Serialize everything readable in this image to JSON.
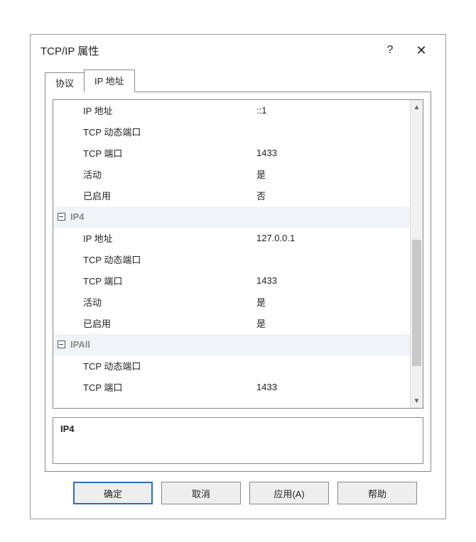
{
  "dialog": {
    "title": "TCP/IP 属性",
    "help_label": "?",
    "close_label": "✕"
  },
  "tabs": {
    "protocol": "协议",
    "ip_address": "IP 地址"
  },
  "rows": [
    {
      "kind": "prop",
      "name": "IP 地址",
      "value": "::1"
    },
    {
      "kind": "prop",
      "name": "TCP 动态端口",
      "value": ""
    },
    {
      "kind": "prop",
      "name": "TCP 端口",
      "value": "1433"
    },
    {
      "kind": "prop",
      "name": "活动",
      "value": "是"
    },
    {
      "kind": "prop",
      "name": "已启用",
      "value": "否"
    },
    {
      "kind": "group",
      "label": "IP4"
    },
    {
      "kind": "prop",
      "name": "IP 地址",
      "value": "127.0.0.1"
    },
    {
      "kind": "prop",
      "name": "TCP 动态端口",
      "value": ""
    },
    {
      "kind": "prop",
      "name": "TCP 端口",
      "value": "1433"
    },
    {
      "kind": "prop",
      "name": "活动",
      "value": "是"
    },
    {
      "kind": "prop",
      "name": "已启用",
      "value": "是"
    },
    {
      "kind": "group",
      "label": "IPAll"
    },
    {
      "kind": "prop",
      "name": "TCP 动态端口",
      "value": ""
    },
    {
      "kind": "prop",
      "name": "TCP 端口",
      "value": "1433"
    }
  ],
  "description": {
    "title": "IP4"
  },
  "buttons": {
    "ok": "确定",
    "cancel": "取消",
    "apply": "应用(A)",
    "help": "帮助"
  },
  "icons": {
    "collapse": "−",
    "scroll_up": "▲",
    "scroll_down": "▼"
  }
}
